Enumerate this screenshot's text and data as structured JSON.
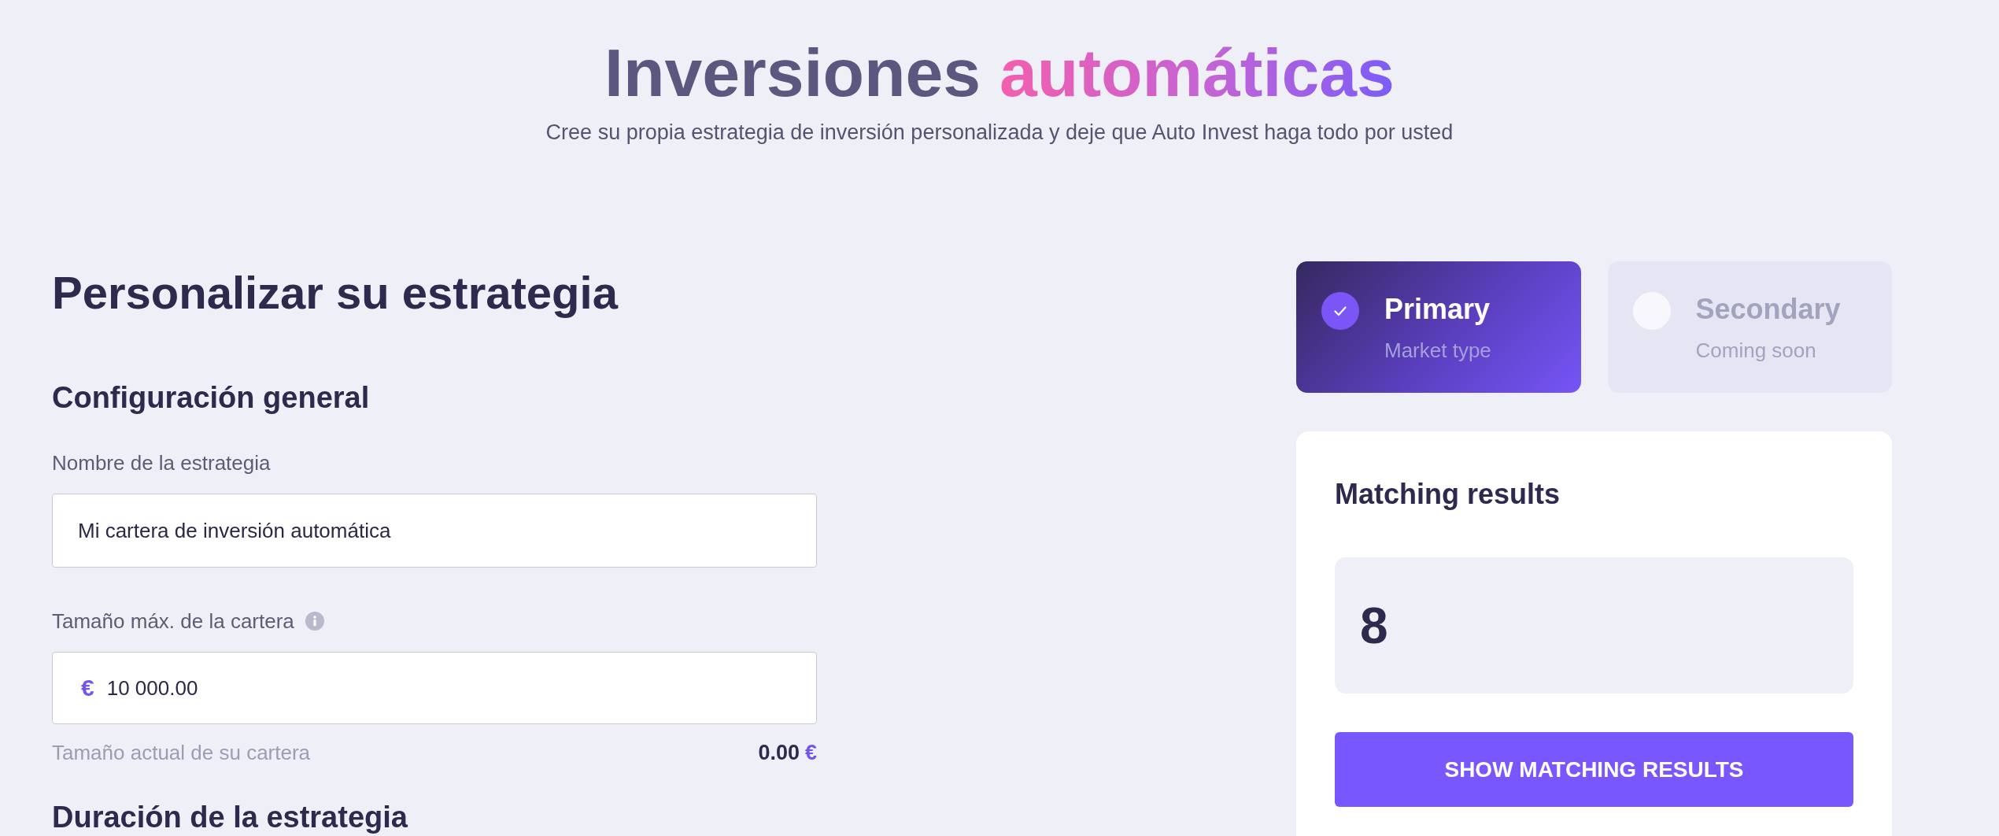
{
  "header": {
    "title": "Inversiones",
    "title_highlight": "automáticas",
    "subtitle": "Cree su propia estrategia de inversión personalizada y deje que Auto Invest haga todo por usted"
  },
  "strategy_form": {
    "heading": "Personalizar su estrategia",
    "section_heading": "Configuración general",
    "name_field": {
      "label": "Nombre de la estrategia",
      "value": "Mi cartera de inversión automática"
    },
    "size_field": {
      "label": "Tamaño máx. de la cartera",
      "currency": "€",
      "value": "10 000.00"
    },
    "current_size": {
      "label": "Tamaño actual de su cartera",
      "value": "0.00",
      "currency": "€"
    },
    "next_section_heading": "Duración de la estrategia"
  },
  "market_types": [
    {
      "title": "Primary",
      "subtitle": "Market type",
      "selected": true,
      "disabled": false
    },
    {
      "title": "Secondary",
      "subtitle": "Coming soon",
      "selected": false,
      "disabled": true
    }
  ],
  "matching_results": {
    "heading": "Matching results",
    "count": "8",
    "button": "SHOW MATCHING RESULTS"
  }
}
